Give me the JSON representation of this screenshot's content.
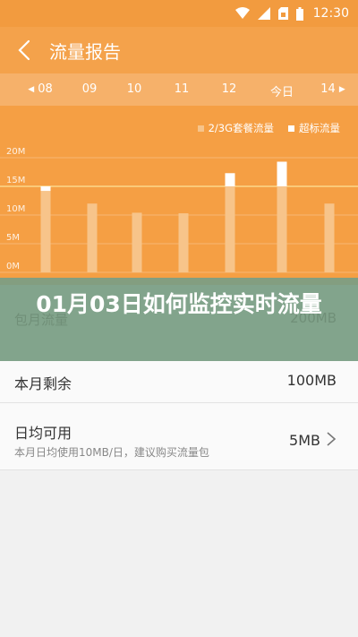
{
  "status_bar": {
    "time": "12:30",
    "icons": [
      "wifi-icon",
      "signal-icon",
      "sim-icon",
      "battery-icon"
    ]
  },
  "header": {
    "title": "流量报告",
    "back_icon": "back-arrow-icon"
  },
  "date_strip": {
    "dates": [
      "08",
      "09",
      "10",
      "11",
      "12",
      "今日",
      "14"
    ],
    "selected": "今日"
  },
  "chart_data": {
    "type": "bar",
    "categories": [
      "08",
      "09",
      "10",
      "11",
      "12",
      "今日",
      "14"
    ],
    "ylabel": "",
    "yticks": [
      "20M",
      "15M",
      "10M",
      "5M",
      "0M"
    ],
    "ylim": [
      0,
      20
    ],
    "series": [
      {
        "name": "2/3G套餐流量",
        "values": [
          14.2,
          12.0,
          10.4,
          10.3,
          15.0,
          15.0,
          12.0
        ],
        "color": "#f7c48a"
      },
      {
        "name": "超标流量",
        "values": [
          0.8,
          0,
          0,
          0,
          2.3,
          4.3,
          0
        ],
        "color": "#ffffff"
      }
    ],
    "reference_line": 15,
    "grid": true,
    "legend_position": "top-right"
  },
  "overlay": {
    "title": "01月03日如何监控实时流量",
    "ghost_label": "包月流量",
    "ghost_value": "200MB"
  },
  "rows": [
    {
      "label": "本月剩余",
      "value": "100MB"
    },
    {
      "label": "日均可用",
      "value": "5MB",
      "sub": "本月日均使用10MB/日，建议购买流量包"
    }
  ],
  "colors": {
    "accent": "#f4a24b",
    "overlay": "#7a9e84"
  }
}
